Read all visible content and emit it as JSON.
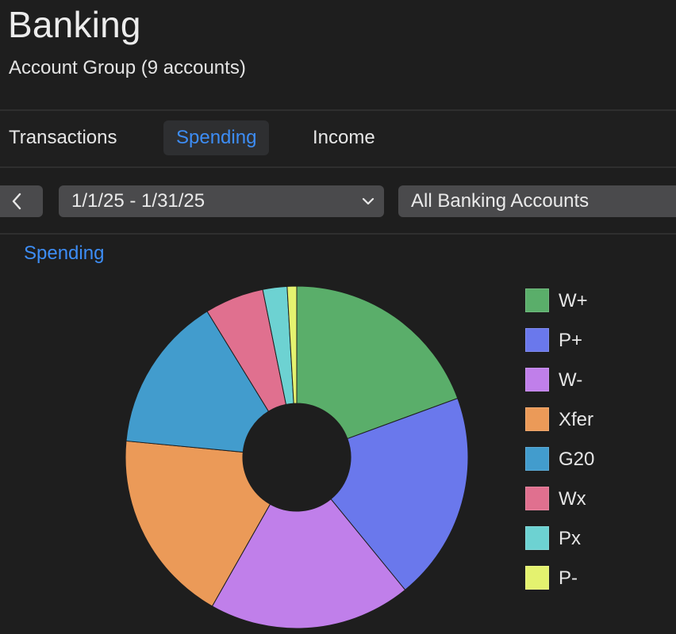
{
  "header": {
    "title": "Banking",
    "subtitle": "Account Group (9 accounts)"
  },
  "tabs": [
    {
      "label": "Transactions",
      "active": false
    },
    {
      "label": "Spending",
      "active": true
    },
    {
      "label": "Income",
      "active": false
    }
  ],
  "toolbar": {
    "date_range": "1/1/25 - 1/31/25",
    "account_filter": "All Banking Accounts"
  },
  "chart_title": "Spending",
  "chart_data": {
    "type": "pie",
    "donut": true,
    "legend_position": "right",
    "categories": [
      "W+",
      "P+",
      "W-",
      "Xfer",
      "G20",
      "Wx",
      "Px",
      "P-"
    ],
    "values": [
      19.5,
      19.8,
      19.2,
      18.4,
      14.8,
      5.6,
      2.3,
      0.9
    ],
    "colors": [
      "#5aae6a",
      "#6a78ec",
      "#c07fea",
      "#eb9a58",
      "#429ccd",
      "#e0708f",
      "#6dd2d2",
      "#e4f26f"
    ]
  }
}
